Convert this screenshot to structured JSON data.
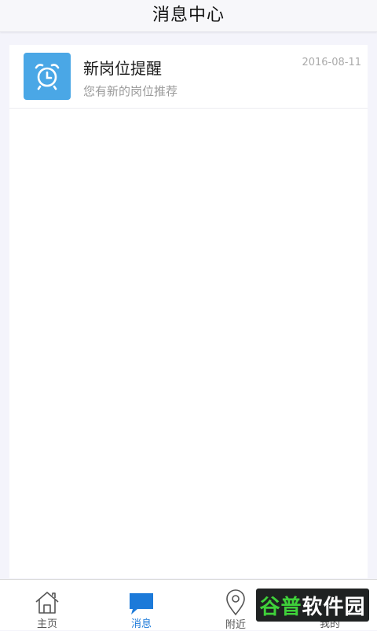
{
  "header": {
    "title": "消息中心"
  },
  "messages": [
    {
      "icon": "alarm-clock-icon",
      "title": "新岗位提醒",
      "subtitle": "您有新的岗位推荐",
      "date": "2016-08-11"
    }
  ],
  "tabbar": {
    "items": [
      {
        "label": "主页",
        "icon": "home-icon",
        "active": false
      },
      {
        "label": "消息",
        "icon": "chat-bubble-icon",
        "active": true
      },
      {
        "label": "附近",
        "icon": "location-pin-icon",
        "active": false
      },
      {
        "label": "我的",
        "icon": "user-icon",
        "active": false
      }
    ]
  },
  "watermark": {
    "part1": "谷普",
    "part2": "软件园"
  },
  "colors": {
    "accent": "#1c7ad9",
    "icon_bg": "#4aa7e6",
    "watermark_green": "#3fd13a"
  }
}
